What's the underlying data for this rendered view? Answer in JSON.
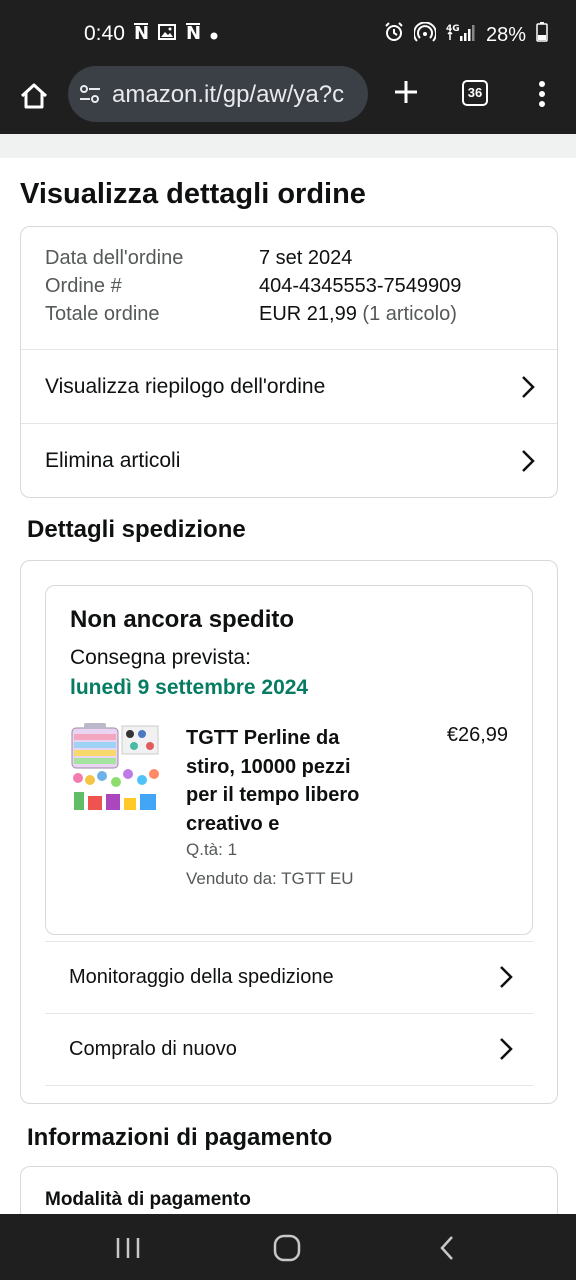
{
  "status_bar": {
    "time": "0:40",
    "network": "4G",
    "battery": "28%"
  },
  "browser": {
    "url": "amazon.it/gp/aw/ya?c",
    "tab_count": "36"
  },
  "page": {
    "title": "Visualizza dettagli ordine"
  },
  "order": {
    "date_label": "Data dell'ordine",
    "date_value": "7 set 2024",
    "number_label": "Ordine #",
    "number_value": "404-4345553-7549909",
    "total_label": "Totale ordine",
    "total_value": "EUR 21,99",
    "total_items": "(1 articolo)",
    "links": [
      {
        "label": "Visualizza riepilogo dell'ordine"
      },
      {
        "label": "Elimina articoli"
      }
    ]
  },
  "shipping": {
    "section_title": "Dettagli spedizione",
    "status": "Non ancora spedito",
    "delivery_label": "Consegna prevista:",
    "delivery_date": "lunedì 9 settembre 2024",
    "product": {
      "name": "TGTT Perline da stiro, 10000 pezzi per il tempo libero creativo e",
      "price": "€26,99",
      "qty": "Q.tà: 1",
      "seller": "Venduto da: TGTT EU"
    },
    "links": [
      {
        "label": "Monitoraggio della spedizione"
      },
      {
        "label": "Compralo di nuovo"
      }
    ]
  },
  "payment": {
    "section_title": "Informazioni di pagamento",
    "method_label": "Modalità di pagamento"
  },
  "colors": {
    "delivery_green": "#067d62",
    "status_bar_bg": "#1f1f1f",
    "url_pill_bg": "#3b3f46"
  },
  "icons": {
    "notifications": [
      "news-icon",
      "image-icon",
      "news-icon",
      "dot-icon"
    ],
    "status_right": [
      "alarm-icon",
      "hotspot-icon",
      "signal-icon",
      "battery-icon"
    ]
  }
}
